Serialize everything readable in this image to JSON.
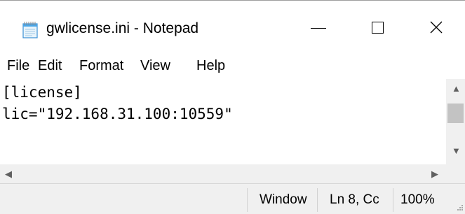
{
  "window": {
    "title": "gwlicense.ini - Notepad"
  },
  "controls": {
    "minimize": "minimize",
    "maximize": "maximize",
    "close": "close"
  },
  "menu": [
    {
      "label": "File"
    },
    {
      "label": "Edit"
    },
    {
      "label": "Format"
    },
    {
      "label": "View"
    },
    {
      "label": "Help"
    }
  ],
  "editor": {
    "content": "[license]\nlic=\"192.168.31.100:10559\""
  },
  "statusbar": {
    "encoding_partial": "Window",
    "position": "Ln 8, Cc",
    "zoom": "100%"
  },
  "icons": {
    "app": "notepad-icon",
    "close": "close-icon",
    "up": "scroll-up-arrow",
    "down": "scroll-down-arrow",
    "left": "scroll-left-arrow",
    "right": "scroll-right-arrow",
    "grip": "resize-grip-icon"
  }
}
